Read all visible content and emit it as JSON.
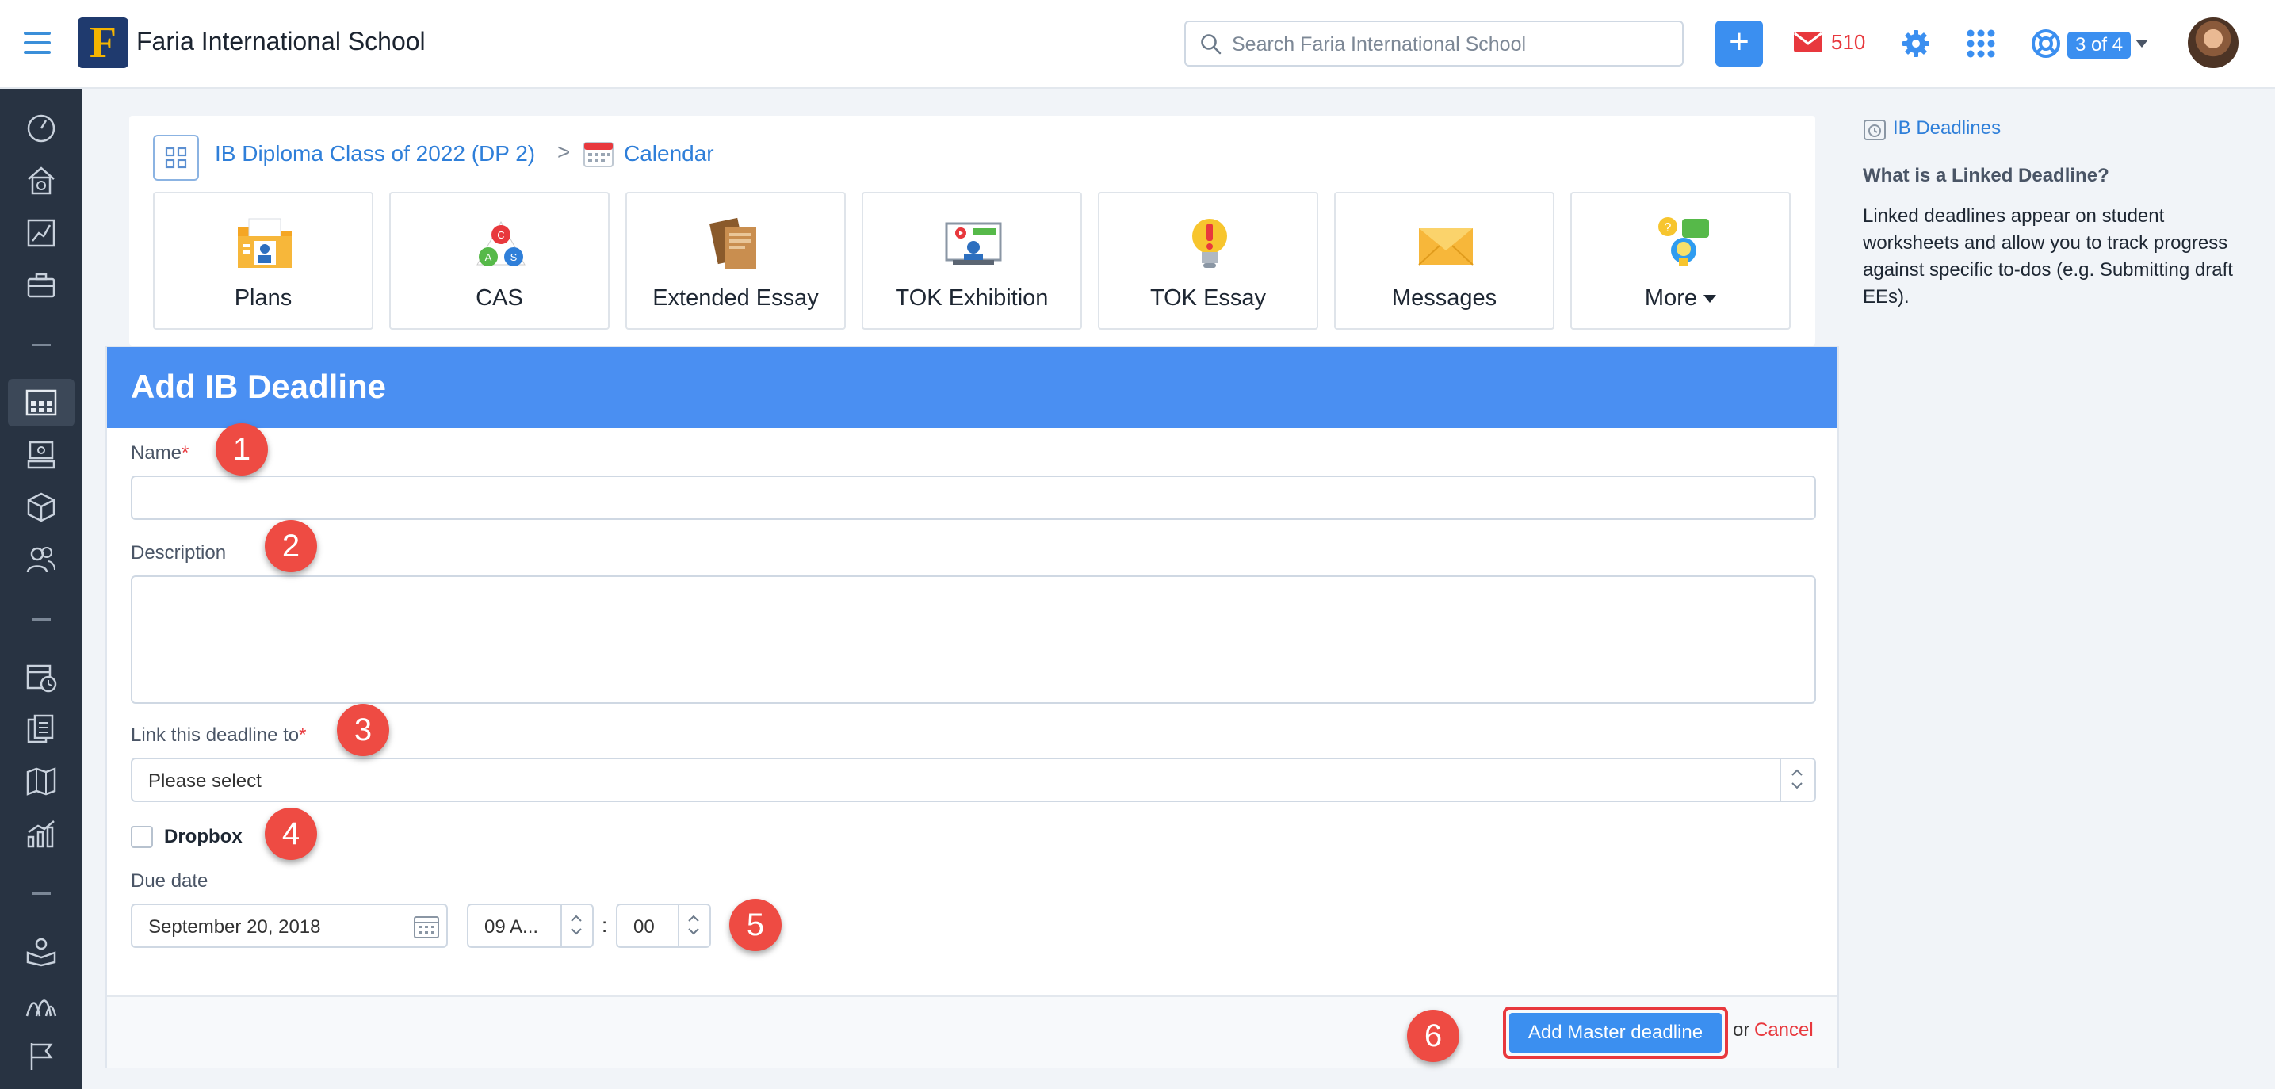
{
  "header": {
    "school_name": "Faria International School",
    "search_placeholder": "Search Faria International School",
    "message_count": "510",
    "help_badge": "3 of 4",
    "accent_color": "#3b8ff0"
  },
  "sidebar": {
    "icons": [
      "dashboard-icon",
      "home-clock-icon",
      "chart-icon",
      "briefcase-icon",
      "classes-icon",
      "student-icon",
      "cube-icon",
      "people-icon",
      "calendar-icon",
      "documents-icon",
      "map-icon",
      "analytics-icon",
      "reading-icon",
      "curriculum-icon",
      "flag-icon"
    ]
  },
  "breadcrumb": {
    "class_name": "IB Diploma Class of 2022 (DP 2)",
    "separator": ">",
    "current": "Calendar"
  },
  "tiles": [
    {
      "label": "Plans",
      "icon": "plans-icon"
    },
    {
      "label": "CAS",
      "icon": "cas-icon"
    },
    {
      "label": "Extended Essay",
      "icon": "extended-essay-icon"
    },
    {
      "label": "TOK Exhibition",
      "icon": "tok-exhibition-icon"
    },
    {
      "label": "TOK Essay",
      "icon": "tok-essay-icon"
    },
    {
      "label": "Messages",
      "icon": "messages-icon"
    },
    {
      "label": "More",
      "icon": "more-icon"
    }
  ],
  "form": {
    "title": "Add IB Deadline",
    "name_label": "Name",
    "required_mark": "*",
    "description_label": "Description",
    "link_label": "Link this deadline to",
    "link_value": "Please select",
    "dropbox_label": "Dropbox",
    "due_date_label": "Due date",
    "due_date_value": "September 20, 2018",
    "hour_value": "09 A...",
    "minute_value": "00",
    "time_separator": ":",
    "submit_label": "Add Master deadline",
    "or_text": "or",
    "cancel_label": "Cancel"
  },
  "markers": [
    "1",
    "2",
    "3",
    "4",
    "5",
    "6"
  ],
  "side_panel": {
    "link_text": "IB Deadlines",
    "title": "What is a Linked Deadline?",
    "text": "Linked deadlines appear on student worksheets and allow you to track progress against specific to-dos (e.g. Submitting draft EEs)."
  }
}
